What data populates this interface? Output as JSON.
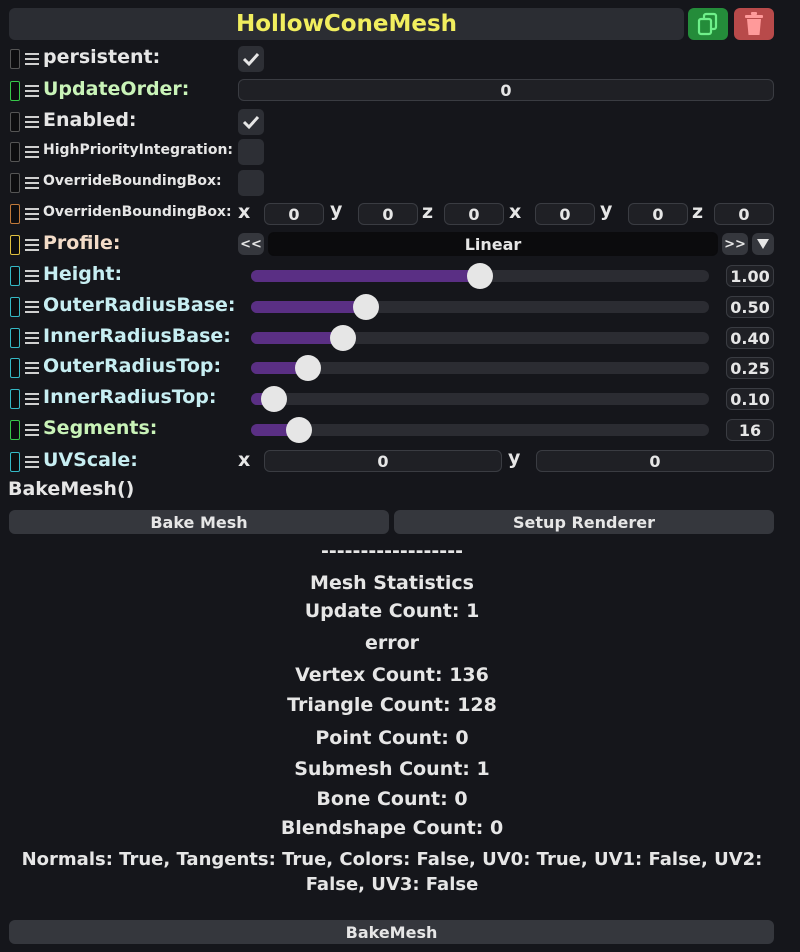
{
  "header": {
    "title": "HollowConeMesh"
  },
  "fields": {
    "persistent": {
      "label": "persistent:",
      "checked": true
    },
    "update_order": {
      "label": "UpdateOrder:",
      "value": "0"
    },
    "enabled": {
      "label": "Enabled:",
      "checked": true
    },
    "high_priority": {
      "label": "HighPriorityIntegration:",
      "checked": false
    },
    "override_bbox": {
      "label": "OverrideBoundingBox:",
      "checked": false
    },
    "overriden_bbox": {
      "label": "OverridenBoundingBox:",
      "axes": [
        "x",
        "y",
        "z",
        "x",
        "y",
        "z"
      ],
      "values": [
        "0",
        "0",
        "0",
        "0",
        "0",
        "0"
      ]
    },
    "profile": {
      "label": "Profile:",
      "prev": "<<",
      "value": "Linear",
      "next": ">>"
    },
    "height": {
      "label": "Height:",
      "value": "1.00",
      "fraction": 0.5
    },
    "outer_radius_base": {
      "label": "OuterRadiusBase:",
      "value": "0.50",
      "fraction": 0.25
    },
    "inner_radius_base": {
      "label": "InnerRadiusBase:",
      "value": "0.40",
      "fraction": 0.2
    },
    "outer_radius_top": {
      "label": "OuterRadiusTop:",
      "value": "0.25",
      "fraction": 0.125
    },
    "inner_radius_top": {
      "label": "InnerRadiusTop:",
      "value": "0.10",
      "fraction": 0.05
    },
    "segments": {
      "label": "Segments:",
      "value": "16",
      "fraction": 0.105
    },
    "uv_scale": {
      "label": "UVScale:",
      "axes": [
        "x",
        "y"
      ],
      "values": [
        "0",
        "0"
      ]
    }
  },
  "method": {
    "label": "BakeMesh()"
  },
  "buttons": {
    "bake_mesh": "Bake Mesh",
    "setup_renderer": "Setup Renderer",
    "bake_mesh_bottom": "BakeMesh"
  },
  "stats": {
    "separator": "------------------",
    "title": "Mesh Statistics",
    "update_count": "Update Count: 1",
    "error": "error",
    "vertex_count": "Vertex Count: 136",
    "triangle_count": "Triangle Count: 128",
    "point_count": "Point Count: 0",
    "submesh_count": "Submesh Count: 1",
    "bone_count": "Bone Count: 0",
    "blendshape_count": "Blendshape Count: 0",
    "attributes_line1": "Normals: True, Tangents: True, Colors: False, UV0: True, UV1: False, UV2:",
    "attributes_line2": "False, UV3: False"
  },
  "colors": {
    "title": "#f1ee5e",
    "slider_fill": "#5a2f84",
    "duplicate": "#248c3a",
    "delete": "#b84a4a",
    "ref_green": "#37c84a",
    "ref_cyan": "#35b9c6",
    "ref_orange": "#c0793a",
    "ref_yellow": "#e0c040",
    "ref_gray": "#555555"
  }
}
